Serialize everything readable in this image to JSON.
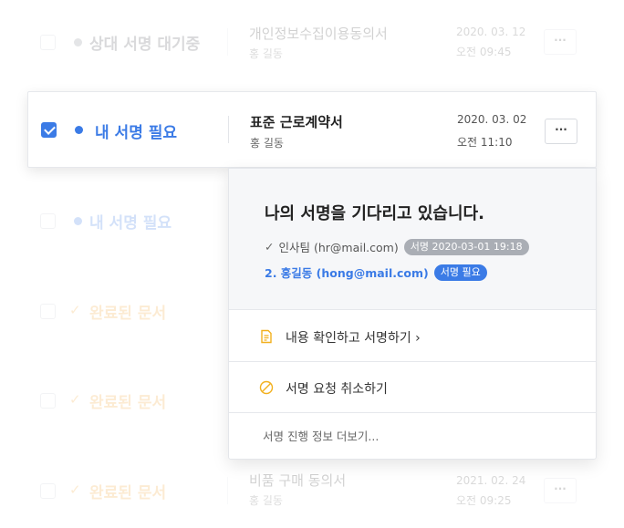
{
  "colors": {
    "accent_blue": "#3b7be6",
    "waiting_gray": "#888c94",
    "complete_orange": "#f2a93b"
  },
  "rows": [
    {
      "status": "상대 서명 대기중",
      "status_icon": "dot-icon",
      "title": "개인정보수집이용동의서",
      "owner": "홍 길동",
      "date": "2020. 03. 12",
      "time": "오전 09:45",
      "more": "···"
    },
    {
      "status": "내 서명 필요",
      "status_icon": "dot-icon",
      "title": "표준 근로계약서",
      "owner": "홍 길동",
      "date": "2020. 03. 02",
      "time": "오전 11:10",
      "more": "···",
      "checked": true
    },
    {
      "status": "내 서명 필요",
      "status_icon": "dot-icon"
    },
    {
      "status": "완료된 문서",
      "status_icon": "check-icon"
    },
    {
      "status": "완료된 문서",
      "status_icon": "check-icon"
    },
    {
      "status": "완료된 문서",
      "status_icon": "check-icon",
      "title": "비품 구매 동의서",
      "owner": "홍 길동",
      "date": "2021. 02. 24",
      "time": "오전 09:25",
      "more": "···"
    }
  ],
  "popup": {
    "heading": "나의 서명을 기다리고 있습니다.",
    "signer1": {
      "check": "✓",
      "text": "인사팀 (hr@mail.com)",
      "badge": "서명 2020-03-01 19:18"
    },
    "signer2": {
      "text": "2. 홍길동 (hong@mail.com)",
      "badge": "서명 필요"
    },
    "actions": [
      {
        "label": "내용 확인하고 서명하기 ›",
        "icon": "document-icon"
      },
      {
        "label": "서명 요청 취소하기",
        "icon": "cancel-icon"
      }
    ],
    "more_info": "서명 진행 정보 더보기..."
  }
}
